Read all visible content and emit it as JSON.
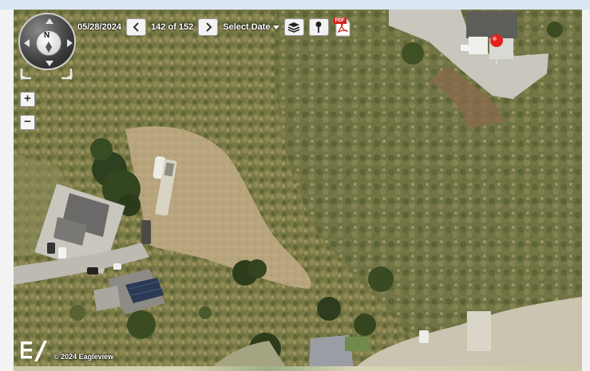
{
  "toolbar": {
    "date": "05/28/2024",
    "prev_icon": "chevron-left-icon",
    "image_counter": "142 of 152",
    "next_icon": "chevron-right-icon",
    "select_date_label": "Select Date",
    "layers_icon": "layers-icon",
    "pin_icon": "map-pin-icon",
    "pdf_icon": "pdf-icon",
    "pdf_badge": "PDF"
  },
  "navigation": {
    "compass_north_label": "N",
    "zoom_in_label": "+",
    "zoom_out_label": "−"
  },
  "footer": {
    "logo": "eagleview-logo",
    "copyright": "© 2024 Eagleview"
  },
  "colors": {
    "marker_red": "#e3221f",
    "button_bg": "#f2f2f2",
    "page_band": "#d9e6f2"
  }
}
